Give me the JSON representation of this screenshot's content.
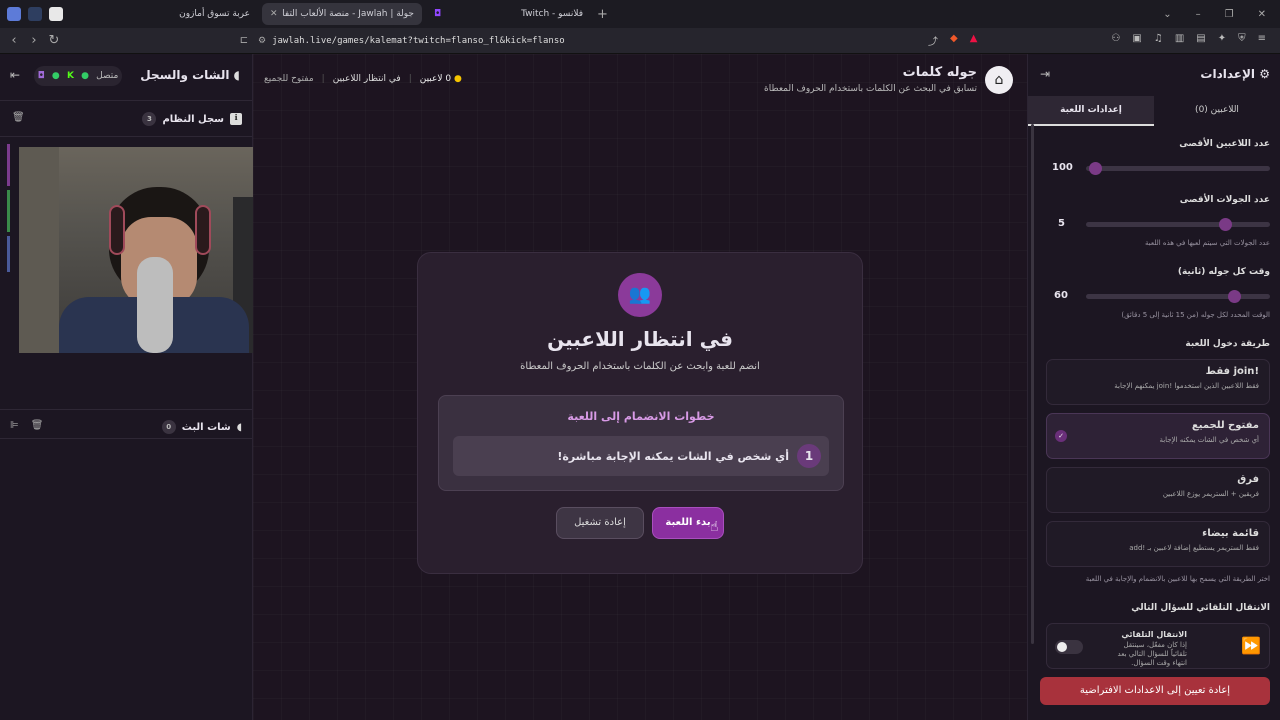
{
  "browser": {
    "tabs": [
      {
        "label": "عربة تسوق أمازون"
      },
      {
        "label": "جولة | Jawlah - منصة الألعاب التفا"
      },
      {
        "label": "فلانسو - Twitch"
      }
    ],
    "url": "jawlah.live/games/kalemat?twitch=flanso_fl&kick=flanso"
  },
  "left": {
    "title": "الشات والسجل",
    "status": "متصل",
    "system_log": {
      "title": "سجل النظام",
      "count": "3"
    },
    "chat": {
      "title": "شات البث",
      "count": "0"
    }
  },
  "header": {
    "title": "جوله كلمات",
    "subtitle": "تسابق في البحث عن الكلمات باستخدام الحروف المعطاة",
    "players": "0 لاعبين",
    "state": "في انتظار اللاعبين",
    "mode": "مفتوح للجميع"
  },
  "waiting": {
    "title": "في انتظار اللاعبين",
    "subtitle": "انضم للعبة وابحث عن الكلمات باستخدام الحروف المعطاة",
    "steps_title": "خطوات الانضمام إلى اللعبة",
    "step_num": "1",
    "step_text": "أي شخص في الشات يمكنه الإجابة مباشرة!",
    "start": "بدء اللعبة",
    "restart": "إعادة تشغيل"
  },
  "settings": {
    "title": "الإعدادات",
    "tab_game": "إعدادات اللعبة",
    "tab_players": "اللاعبين (0)",
    "max_players": {
      "label": "عدد اللاعبين الأقصى",
      "value": "100",
      "level": 0.02
    },
    "max_rounds": {
      "label": "عدد الجولات الأقصى",
      "value": "5",
      "hint": "عدد الجولات التي سيتم لعبها في هذه اللعبة",
      "level": 0.78
    },
    "round_time": {
      "label": "وقت كل جوله (ثانية)",
      "value": "60",
      "hint": "الوقت المحدد لكل جوله (من 15 ثانية إلى 5 دقائق)",
      "level": 0.83
    },
    "join_label": "طريقة دخول اللعبة",
    "join_options": [
      {
        "title": "!join فقط",
        "desc": "فقط اللاعبين الذين استخدموا !join يمكنهم الإجابة"
      },
      {
        "title": "مفتوح للجميع",
        "desc": "أي شخص في الشات يمكنه الإجابة"
      },
      {
        "title": "فرق",
        "desc": "فريقين + الستريمر يوزع اللاعبين"
      },
      {
        "title": "قائمة بيضاء",
        "desc": "فقط الستريمر يستطيع إضافة لاعبين بـ !add"
      }
    ],
    "join_hint": "اختر الطريقة التي يسمح بها للاعبين بالانضمام والإجابة في اللعبة",
    "auto_label": "الانتقال التلقائي للسؤال التالي",
    "auto_title": "الانتقال التلقائي",
    "auto_desc": "إذا كان مفعّل، سينتقل تلقائياً للسؤال التالي بعد انتهاء وقت السؤال.",
    "reset": "إعادة تعيين إلى الاعدادات الافتراضية"
  },
  "colors": {
    "accent": "#8b3a9a",
    "danger": "#a8323c",
    "bg": "#1d1420"
  }
}
